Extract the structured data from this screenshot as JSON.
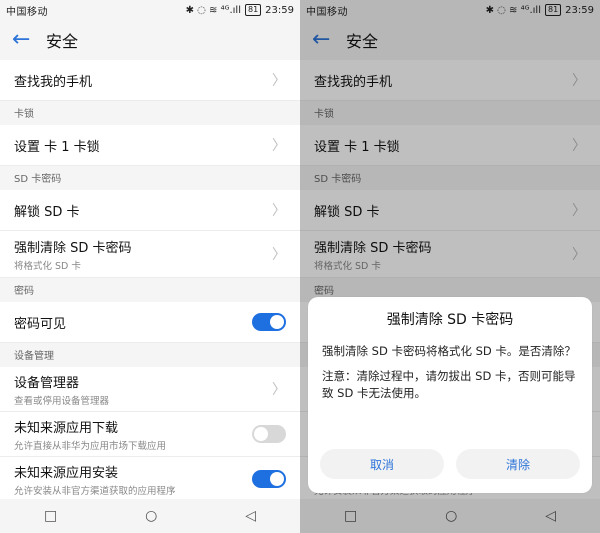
{
  "statusbar": {
    "carrier": "中国移动",
    "icons": "✱ ◌ ≋ ⁴ᴳ.ıll",
    "battery": "81",
    "time": "23:59"
  },
  "header": {
    "title": "安全"
  },
  "rows": {
    "find_phone": "查找我的手机",
    "sim_lock_section": "卡锁",
    "set_sim_lock": "设置 卡 1 卡锁",
    "sd_password_section": "SD 卡密码",
    "unlock_sd": "解锁 SD 卡",
    "force_clear_sd": "强制清除 SD 卡密码",
    "force_clear_sd_sub": "将格式化 SD 卡",
    "password_section": "密码",
    "password_visible": "密码可见",
    "device_mgmt_section": "设备管理",
    "device_manager": "设备管理器",
    "device_manager_sub": "查看或停用设备管理器",
    "unknown_download": "未知来源应用下载",
    "unknown_download_sub": "允许直接从非华为应用市场下载应用",
    "unknown_install": "未知来源应用安装",
    "unknown_install_sub": "允许安装从非官方渠道获取的应用程序"
  },
  "toggles": {
    "password_visible": true,
    "unknown_download": false,
    "unknown_install": true
  },
  "nav": {
    "recent": "□",
    "home": "○",
    "back": "◁"
  },
  "dialog": {
    "title": "强制清除 SD 卡密码",
    "message": "强制清除 SD 卡密码将格式化 SD 卡。是否清除？",
    "note": "注意：清除过程中，请勿拔出 SD 卡，否则可能导致 SD 卡无法使用。",
    "cancel": "取消",
    "confirm": "清除"
  },
  "colors": {
    "accent": "#2d74d9",
    "toggle_on": "#1e6fe0",
    "toggle_off": "#d8d8d8",
    "background": "#f5f5f5"
  }
}
